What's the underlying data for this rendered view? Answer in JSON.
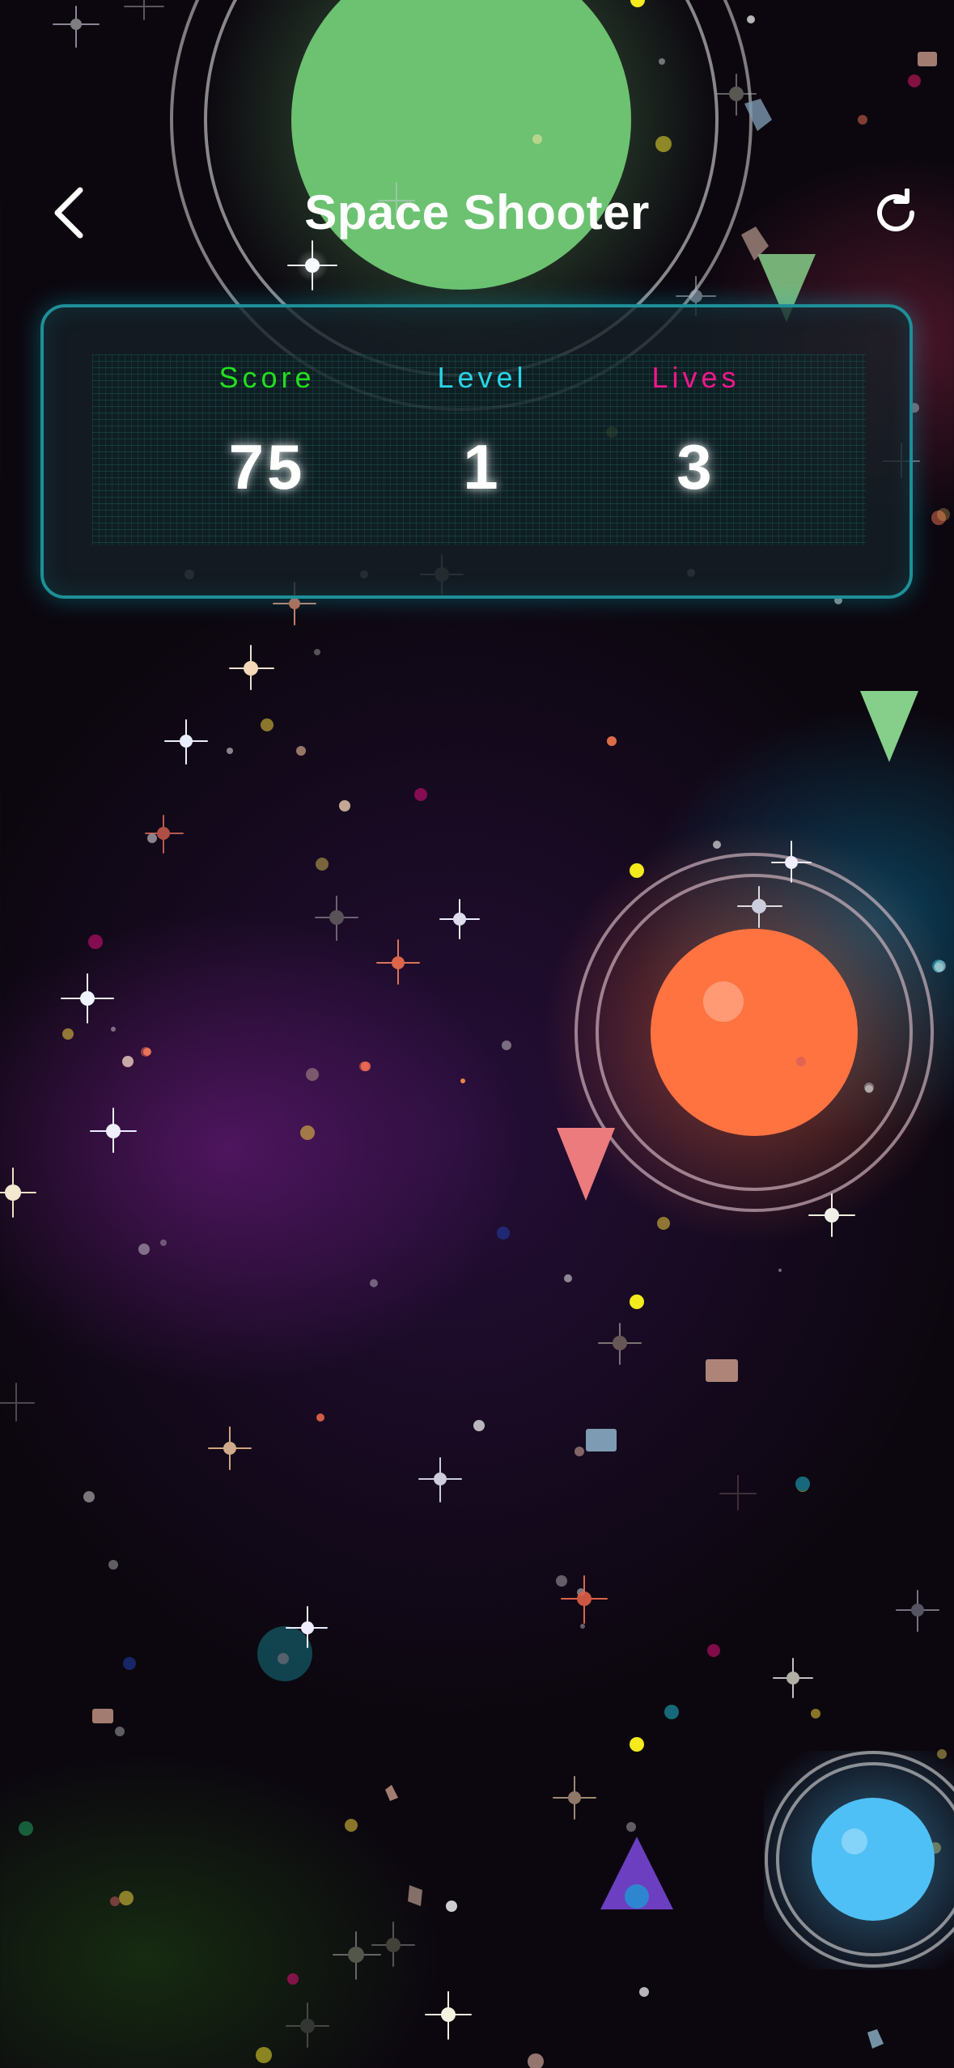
{
  "header": {
    "title": "Space Shooter",
    "back_icon": "chevron-left-icon",
    "restart_icon": "refresh-icon"
  },
  "stats": {
    "score": {
      "label": "Score",
      "value": "75",
      "color": "#22e01e"
    },
    "level": {
      "label": "Level",
      "value": "1",
      "color": "#28d6e8"
    },
    "lives": {
      "label": "Lives",
      "value": "3",
      "color": "#f0178c"
    }
  },
  "game": {
    "planet_colors": {
      "green": "#6cc270",
      "orange": "#ff7341",
      "blue": "#4fc0f5"
    },
    "player_ship_color": "#6b3fc0",
    "enemy_colors": {
      "green": "#86cf8a",
      "red": "#ec7b7e"
    },
    "bullet_color": "#f5ea1c"
  }
}
